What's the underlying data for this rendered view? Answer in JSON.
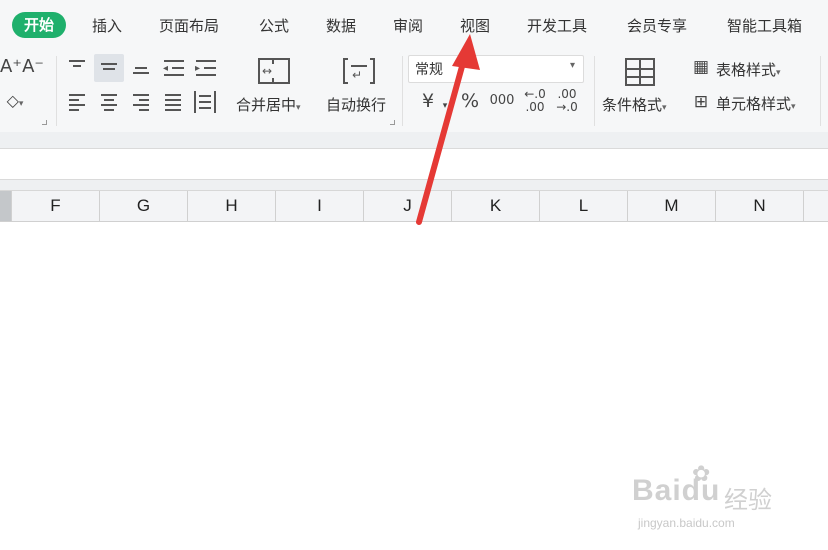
{
  "tabs": [
    {
      "label": "开始",
      "active": true
    },
    {
      "label": "插入"
    },
    {
      "label": "页面布局"
    },
    {
      "label": "公式"
    },
    {
      "label": "数据"
    },
    {
      "label": "审阅"
    },
    {
      "label": "视图"
    },
    {
      "label": "开发工具"
    },
    {
      "label": "会员专享"
    },
    {
      "label": "智能工具箱"
    }
  ],
  "toolbar": {
    "font_grow": "A⁺",
    "font_shrink": "A⁻",
    "merge_center": "合并居中",
    "wrap_text": "自动换行",
    "number_format": "常规",
    "currency": "¥",
    "percent": "%",
    "thousands": "000",
    "dec_increase": "←.0\n.00",
    "dec_decrease": ".00\n→.0",
    "conditional_format": "条件格式",
    "table_style": "表格样式",
    "cell_style": "单元格样式"
  },
  "columns": [
    "F",
    "G",
    "H",
    "I",
    "J",
    "K",
    "L",
    "M",
    "N"
  ],
  "watermark": {
    "brand": "Baidu",
    "brand_cn": "经验",
    "url": "jingyan.baidu.com"
  },
  "colors": {
    "active_tab": "#1fb06c",
    "arrow": "#e53935"
  }
}
